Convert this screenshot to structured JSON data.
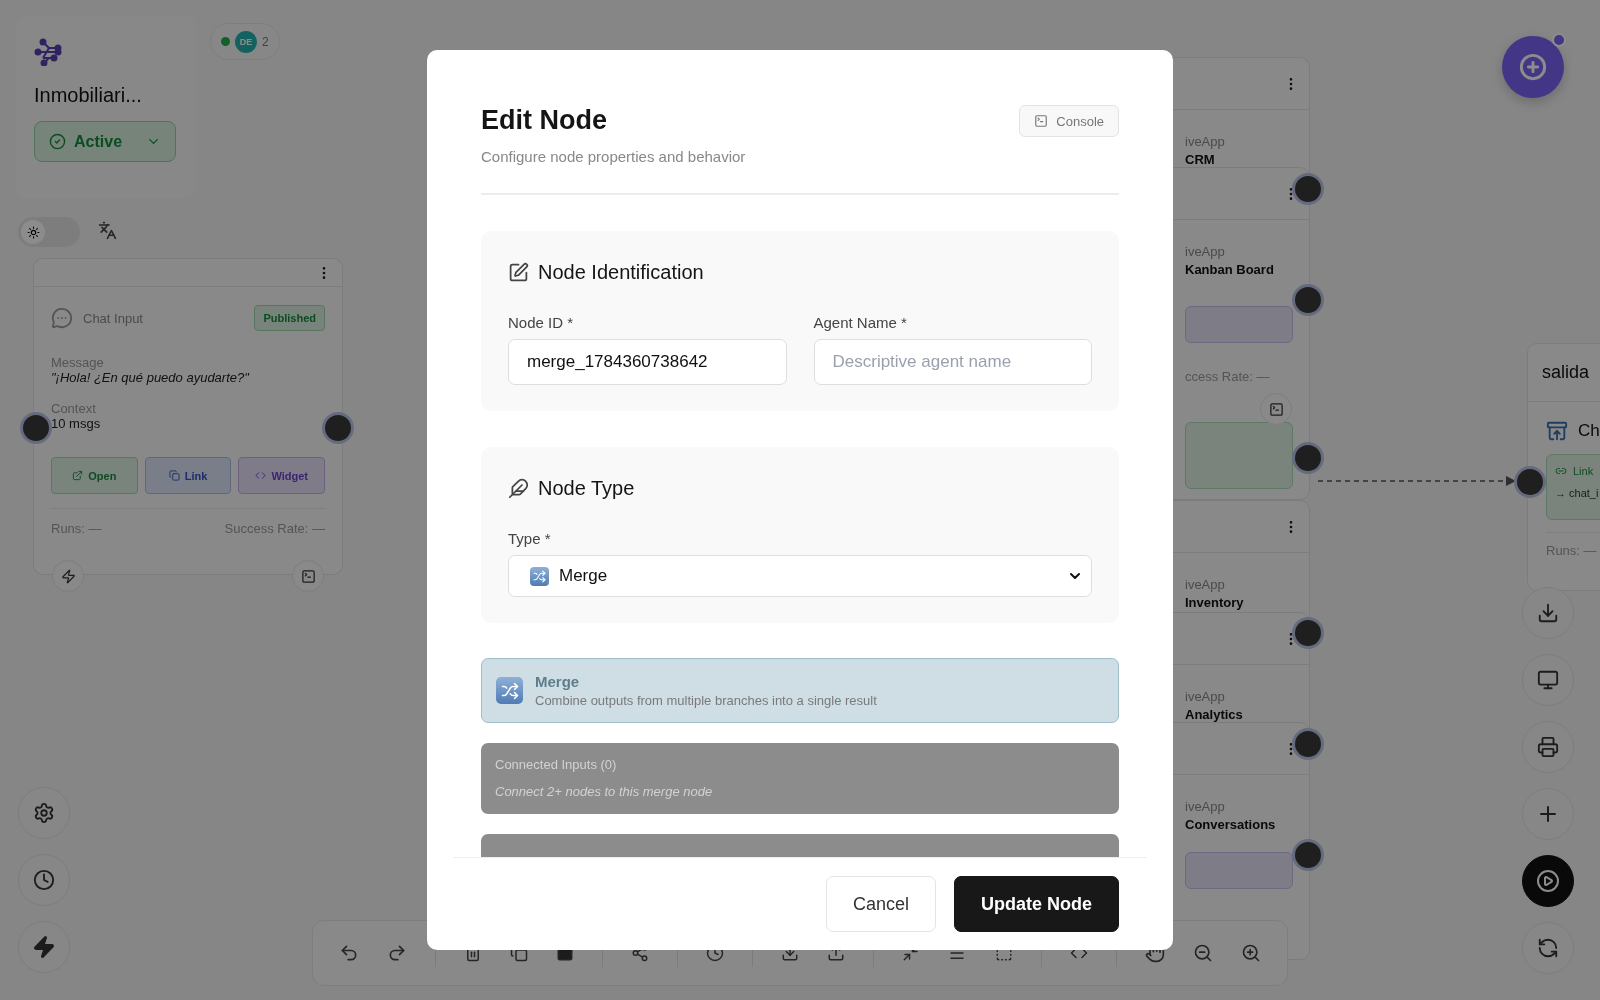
{
  "project": {
    "title": "Inmobiliari...",
    "status": "Active"
  },
  "presence": {
    "initials": "DE",
    "count": "2"
  },
  "theme_toggle": {
    "on": false
  },
  "chat_node": {
    "title": "Chat Input",
    "badge": "Published",
    "fields": [
      {
        "label": "Message",
        "value": "\"¡Hola! ¿En qué puedo ayudarte?\"",
        "kind": "quote"
      },
      {
        "label": "Context",
        "value": "10 msgs",
        "kind": "plain"
      }
    ],
    "actions": [
      {
        "label": "Open",
        "kind": "open"
      },
      {
        "label": "Link",
        "kind": "link"
      },
      {
        "label": "Widget",
        "kind": "widget"
      }
    ],
    "runs": "Runs: —",
    "success_rate": "Success Rate: —"
  },
  "background_nodes": [
    {
      "type": "iveApp",
      "name": "CRM"
    },
    {
      "type": "iveApp",
      "name": "Kanban Board",
      "footer": "ccess Rate: —"
    },
    {
      "type": "iveApp",
      "name": "Inventory"
    },
    {
      "type": "iveApp",
      "name": "Analytics"
    },
    {
      "type": "iveApp",
      "name": "Conversations"
    }
  ],
  "output_node": {
    "title": "salida",
    "name": "Ch",
    "link": "Link",
    "target": "→ chat_i",
    "runs": "Runs: —"
  },
  "modal": {
    "title": "Edit Node",
    "subtitle": "Configure node properties and behavior",
    "console_button": "Console",
    "sections": [
      {
        "kind": "identification",
        "title": "Node Identification",
        "fields": [
          {
            "label": "Node ID *",
            "value": "merge_1784360738642"
          },
          {
            "label": "Agent Name *",
            "placeholder": "Descriptive agent name"
          }
        ]
      },
      {
        "kind": "type",
        "title": "Node Type",
        "fields": [
          {
            "label": "Type *",
            "value": "Merge",
            "kind": "select"
          }
        ]
      }
    ],
    "type_info": {
      "title": "Merge",
      "description": "Combine outputs from multiple branches into a single result"
    },
    "inputs_panel": {
      "title": "Connected Inputs (0)",
      "hint": "Connect 2+ nodes to this merge node"
    },
    "buttons": [
      {
        "label": "Cancel",
        "kind": "secondary"
      },
      {
        "label": "Update Node",
        "kind": "primary"
      }
    ]
  }
}
